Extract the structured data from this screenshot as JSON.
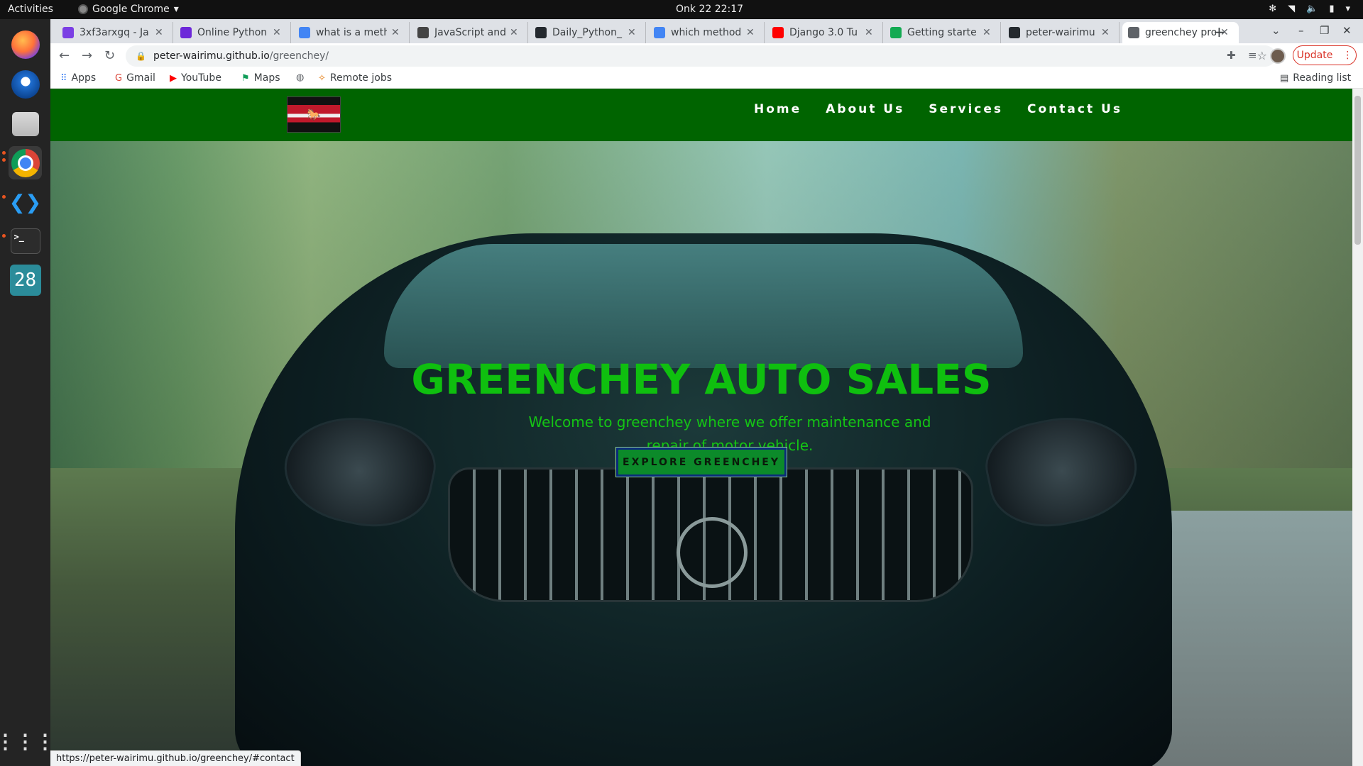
{
  "system": {
    "activities": "Activities",
    "app_name": "Google Chrome",
    "clock": "Onk 22  22:17"
  },
  "dock": {
    "calendar_day": "28",
    "terminal_prompt": ">_"
  },
  "browser": {
    "tabs": [
      {
        "title": "3xf3arxgq - Ja",
        "icon": "replit-icon",
        "color": "#7b3fe4"
      },
      {
        "title": "Online Python",
        "icon": "programiz-icon",
        "color": "#6d28d9"
      },
      {
        "title": "what is a meth",
        "icon": "google-icon",
        "color": "#4285f4"
      },
      {
        "title": "JavaScript and",
        "icon": "freecodecamp-icon",
        "color": "#444444"
      },
      {
        "title": "Daily_Python_",
        "icon": "github-icon",
        "color": "#24292e"
      },
      {
        "title": "which method",
        "icon": "google-icon",
        "color": "#4285f4"
      },
      {
        "title": "Django 3.0 Tu",
        "icon": "youtube-icon",
        "color": "#ff0000"
      },
      {
        "title": "Getting starte",
        "icon": "leaf-icon",
        "color": "#13aa52"
      },
      {
        "title": "peter-wairimu",
        "icon": "github-icon",
        "color": "#24292e"
      },
      {
        "title": "greenchey pro",
        "icon": "globe-icon",
        "color": "#5f6368"
      }
    ],
    "url_host": "peter-wairimu.github.io",
    "url_path": "/greenchey/",
    "update_label": "Update",
    "bookmarks": [
      {
        "label": "Apps",
        "icon": "apps-icon"
      },
      {
        "label": "Gmail",
        "icon": "google-icon"
      },
      {
        "label": "YouTube",
        "icon": "youtube-icon"
      },
      {
        "label": "Maps",
        "icon": "maps-icon"
      },
      {
        "label": "",
        "icon": "globe-icon"
      },
      {
        "label": "Remote jobs",
        "icon": "remote-jobs-icon"
      }
    ],
    "reading_list": "Reading list",
    "status_url": "https://peter-wairimu.github.io/greenchey/#contact"
  },
  "site": {
    "nav": [
      "Home",
      "About Us",
      "Services",
      "Contact Us"
    ],
    "hero_title": "GREENCHEY AUTO SALES",
    "hero_subtitle": "Welcome to greenchey where we offer maintenance and repair of motor vehicle.",
    "cta_label": "EXPLORE GREENCHEY",
    "colors": {
      "nav_bg": "#006400",
      "title_green": "#0fbf0f",
      "cta_bg": "#0c8a2a"
    }
  }
}
